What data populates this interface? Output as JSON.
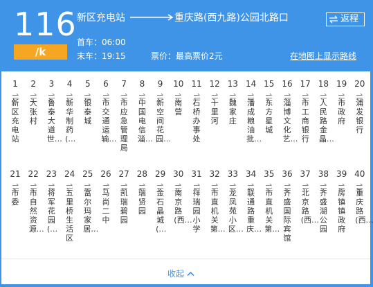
{
  "header": {
    "route_number": "116",
    "fare_badge": "/k",
    "from_station": "新区充电站",
    "to_station": "重庆路(西九路)公园北路口",
    "return_label": "返程",
    "first_bus": "首车：06:00",
    "last_bus": "末车：19:15",
    "fare": "票价：最高票价2元",
    "show_on_map": "在地图上显示路线"
  },
  "stops": [
    {
      "num": "1",
      "name": "新区充电站"
    },
    {
      "num": "2",
      "name": "大张村"
    },
    {
      "num": "3",
      "name": "鲁泰大道世…"
    },
    {
      "num": "4",
      "name": "新华制药(…"
    },
    {
      "num": "5",
      "name": "银泰城"
    },
    {
      "num": "6",
      "name": "市交通运输…"
    },
    {
      "num": "7",
      "name": "市应急管理局"
    },
    {
      "num": "8",
      "name": "中国电信淄…"
    },
    {
      "num": "9",
      "name": "新空间花园…"
    },
    {
      "num": "10",
      "name": "南营"
    },
    {
      "num": "11",
      "name": "石桥办事处"
    },
    {
      "num": "12",
      "name": "十里河"
    },
    {
      "num": "13",
      "name": "魏家庄"
    },
    {
      "num": "14",
      "name": "潘成粮油批…"
    },
    {
      "num": "15",
      "name": "东方星城"
    },
    {
      "num": "16",
      "name": "淄博文化艺…"
    },
    {
      "num": "17",
      "name": "市工商银行"
    },
    {
      "num": "18",
      "name": "人民路金晶…"
    },
    {
      "num": "19",
      "name": "市政府"
    },
    {
      "num": "20",
      "name": "浦发银行"
    },
    {
      "num": "21",
      "name": "市委"
    },
    {
      "num": "22",
      "name": "市自然资源…"
    },
    {
      "num": "23",
      "name": "将军花园(…"
    },
    {
      "num": "24",
      "name": "五里桥生活区"
    },
    {
      "num": "25",
      "name": "富尔玛家居…"
    },
    {
      "num": "26",
      "name": "马尚二中"
    },
    {
      "num": "27",
      "name": "凯瑞碧园"
    },
    {
      "num": "28",
      "name": "瑞贤园"
    },
    {
      "num": "29",
      "name": "金石晶城(…"
    },
    {
      "num": "30",
      "name": "南京路(西…"
    },
    {
      "num": "31",
      "name": "祥瑞园小学"
    },
    {
      "num": "32",
      "name": "市直机关第…"
    },
    {
      "num": "33",
      "name": "龙凤苑小区…"
    },
    {
      "num": "34",
      "name": "联通路重庆…"
    },
    {
      "num": "35",
      "name": "市直机关第…"
    },
    {
      "num": "36",
      "name": "齐盛国际宾馆"
    },
    {
      "num": "37",
      "name": "北京路(西…"
    },
    {
      "num": "38",
      "name": "齐盛湖公园"
    },
    {
      "num": "39",
      "name": "房镇镇政府"
    },
    {
      "num": "40",
      "name": "重庆路(西…"
    }
  ],
  "footer": {
    "collapse_label": "收起"
  },
  "colors": {
    "header_bg": "#3f94e8",
    "fare_badge_bg": "#f5a623",
    "stop_text": "#333333",
    "link_blue": "#3f94e8"
  }
}
